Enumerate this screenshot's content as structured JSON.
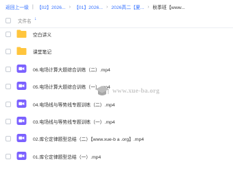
{
  "breadcrumb": {
    "back": "返回上一级",
    "items": [
      "【02】2026...",
      "【01】2026...",
      "2026高二【夏..."
    ],
    "current": "秋季班【www..."
  },
  "header": {
    "label": "文件名",
    "sort_icon": "arrow-down-icon"
  },
  "files": [
    {
      "name": "空白讲义",
      "type": "folder"
    },
    {
      "name": "课堂笔记",
      "type": "folder"
    },
    {
      "name": "06.电场计算大题综合训练（二）.mp4",
      "type": "video"
    },
    {
      "name": "05.电场计算大题综合训练（一）.mp4",
      "type": "video"
    },
    {
      "name": "04.电场线与等势线专题训练（二）.mp4",
      "type": "video"
    },
    {
      "name": "03.电场线与等势线专题训练（一）.mp4",
      "type": "video"
    },
    {
      "name": "02.库仑定律题型总结（二）【www.xue-b a .org】.mp4",
      "type": "video"
    },
    {
      "name": "01.库仑定律题型总结（一）.mp4",
      "type": "video"
    }
  ],
  "watermark": {
    "text": "www.xue-ba.org"
  },
  "colors": {
    "link": "#3370ff",
    "folder": "#ffc53d",
    "video": "#7b61ff"
  }
}
